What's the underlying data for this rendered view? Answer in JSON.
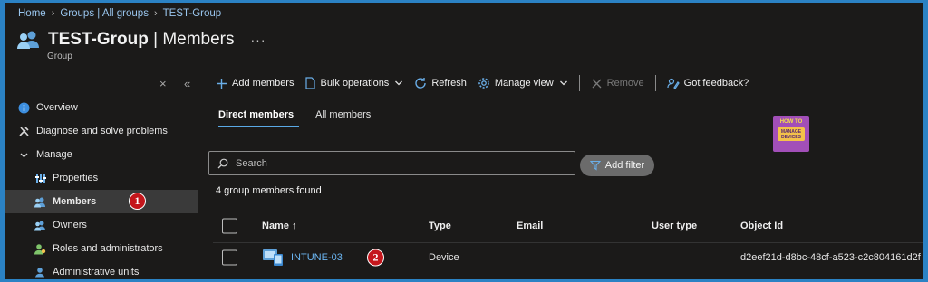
{
  "breadcrumb": [
    "Home",
    "Groups | All groups",
    "TEST-Group"
  ],
  "page": {
    "title_bold": "TEST-Group",
    "title_rest": " | Members",
    "more": "···",
    "subtitle": "Group"
  },
  "sidebar_controls": {
    "close": "×",
    "collapse": "«"
  },
  "sidebar": {
    "overview": "Overview",
    "diagnose": "Diagnose and solve problems",
    "manage": "Manage",
    "properties": "Properties",
    "members": "Members",
    "owners": "Owners",
    "roles": "Roles and administrators",
    "admin_units": "Administrative units"
  },
  "toolbar": {
    "add_members": "Add members",
    "bulk_operations": "Bulk operations",
    "refresh": "Refresh",
    "manage_view": "Manage view",
    "remove": "Remove",
    "feedback": "Got feedback?"
  },
  "tabs": {
    "direct": "Direct members",
    "all": "All members"
  },
  "logo": {
    "top": "HOW TO",
    "line1": "MANAGE",
    "line2": "DEVICES"
  },
  "search": {
    "placeholder": "Search"
  },
  "filter": {
    "label": "Add filter"
  },
  "found_text": "4 group members found",
  "table": {
    "columns": {
      "name": "Name ↑",
      "type": "Type",
      "email": "Email",
      "user_type": "User type",
      "object_id": "Object Id"
    },
    "rows": [
      {
        "name": "INTUNE-03",
        "type": "Device",
        "email": "",
        "user_type": "",
        "object_id": "d2eef21d-d8bc-48cf-a523-c2c804161d2f"
      }
    ]
  },
  "annotations": {
    "one": "1",
    "two": "2"
  },
  "colors": {
    "accent": "#5aa9e6",
    "link": "#6cb7f3",
    "badge": "#c4161c",
    "border": "#2b82c4"
  }
}
